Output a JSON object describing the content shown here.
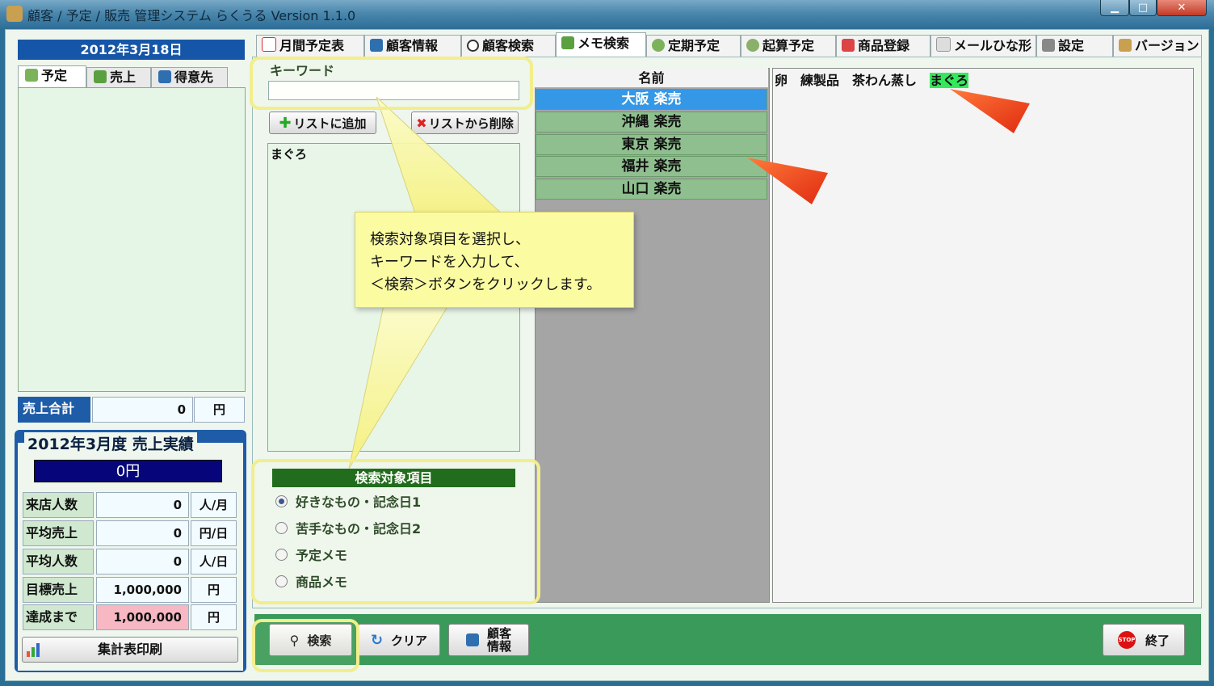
{
  "window": {
    "title": "顧客 / 予定 / 販売 管理システム らくうる  Version 1.1.0",
    "minimize": "▁",
    "maximize": "□",
    "close": "✕"
  },
  "left_panel": {
    "date": "2012年3月18日",
    "tabs": [
      {
        "label": "予定"
      },
      {
        "label": "売上"
      },
      {
        "label": "得意先"
      }
    ],
    "sales_total": {
      "label": "売上合計",
      "value": "0",
      "unit": "円"
    },
    "monthly": {
      "title": "2012年3月度  売上実績",
      "total": "0円",
      "stats": [
        {
          "label": "来店人数",
          "value": "0",
          "unit": "人/月"
        },
        {
          "label": "平均売上",
          "value": "0",
          "unit": "円/日"
        },
        {
          "label": "平均人数",
          "value": "0",
          "unit": "人/日"
        },
        {
          "label": "目標売上",
          "value": "1,000,000",
          "unit": "円"
        },
        {
          "label": "達成まで",
          "value": "1,000,000",
          "unit": "円"
        }
      ],
      "print_button": "集計表印刷"
    }
  },
  "top_tabs": [
    {
      "label": "月間予定表"
    },
    {
      "label": "顧客情報"
    },
    {
      "label": "顧客検索"
    },
    {
      "label": "メモ検索"
    },
    {
      "label": "定期予定"
    },
    {
      "label": "起算予定"
    },
    {
      "label": "商品登録"
    },
    {
      "label": "メールひな形"
    },
    {
      "label": "設定"
    },
    {
      "label": "バージョン"
    }
  ],
  "memo_search": {
    "keyword_label": "キーワード",
    "keyword_value": "",
    "add_button": "リストに追加",
    "remove_button": "リストから削除",
    "keyword_list": [
      "まぐろ"
    ],
    "target_header": "検索対象項目",
    "targets": [
      {
        "label": "好きなもの・記念日1",
        "checked": true
      },
      {
        "label": "苦手なもの・記念日2",
        "checked": false
      },
      {
        "label": "予定メモ",
        "checked": false
      },
      {
        "label": "商品メモ",
        "checked": false
      }
    ],
    "names_header": "名前",
    "names": [
      {
        "name": "大阪 楽売",
        "selected": true
      },
      {
        "name": "沖縄 楽売",
        "selected": false
      },
      {
        "name": "東京 楽売",
        "selected": false
      },
      {
        "name": "福井 楽売",
        "selected": false
      },
      {
        "name": "山口 楽売",
        "selected": false
      }
    ],
    "memo_words": [
      "卵",
      "練製品",
      "茶わん蒸し",
      "まぐろ"
    ]
  },
  "bottom": {
    "search": "検索",
    "clear": "クリア",
    "customer_line1": "顧客",
    "customer_line2": "情報",
    "exit": "終了",
    "stop_icon_text": "STOP"
  },
  "callout": {
    "line1": "検索対象項目を選択し、",
    "line2": "キーワードを入力して、",
    "line3": "＜検索＞ボタンをクリックします。"
  },
  "colors": {
    "selected_row": "#3598e6",
    "highlight_word": "#34e85e",
    "callout_bg": "#fbfba2",
    "arrow": "#ff4a1a"
  }
}
